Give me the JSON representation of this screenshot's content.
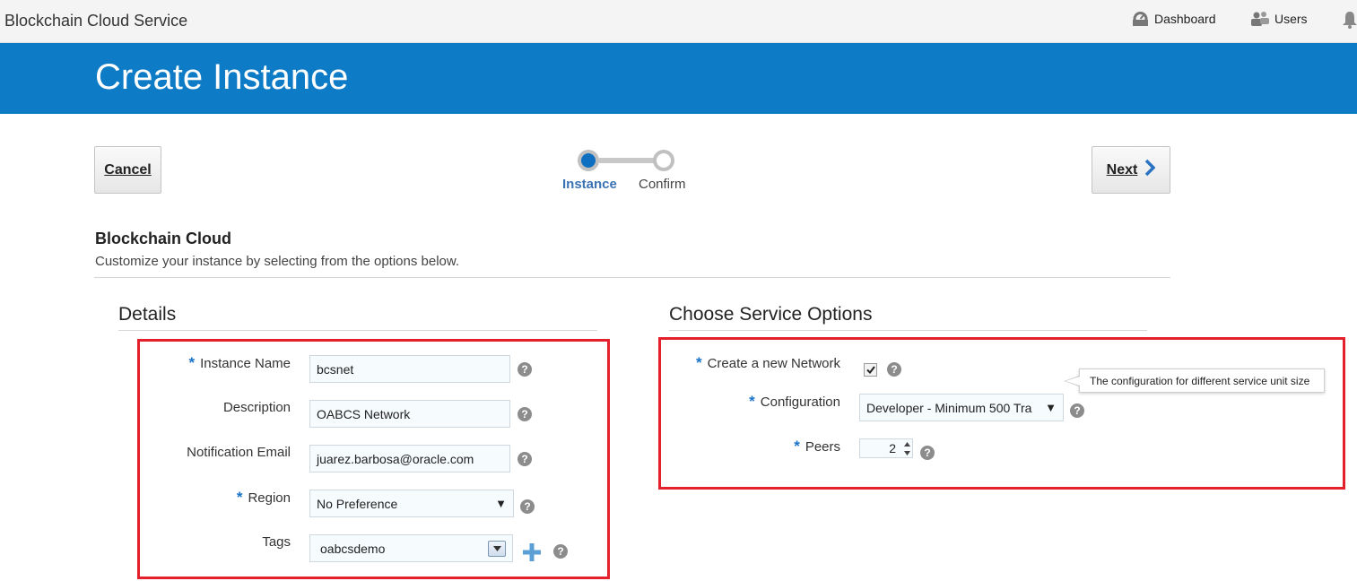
{
  "app": {
    "title": "Blockchain Cloud Service",
    "nav": {
      "dashboard_label": "Dashboard",
      "users_label": "Users"
    }
  },
  "header": {
    "title": "Create Instance"
  },
  "toolbar": {
    "cancel_label": "Cancel",
    "next_label": "Next"
  },
  "train": {
    "steps": [
      {
        "label": "Instance",
        "state": "current"
      },
      {
        "label": "Confirm",
        "state": "upcoming"
      }
    ]
  },
  "section": {
    "title": "Blockchain Cloud",
    "subtitle": "Customize your instance by selecting from the options below."
  },
  "details": {
    "title": "Details",
    "instance_name": {
      "label": "Instance Name",
      "value": "bcsnet",
      "required": true
    },
    "description": {
      "label": "Description",
      "value": "OABCS Network",
      "required": false
    },
    "notification_email": {
      "label": "Notification Email",
      "value": "juarez.barbosa@oracle.com",
      "required": false
    },
    "region": {
      "label": "Region",
      "value": "No Preference",
      "required": true
    },
    "tags": {
      "label": "Tags",
      "value": "oabcsdemo",
      "required": false
    }
  },
  "options": {
    "title": "Choose Service Options",
    "create_network": {
      "label": "Create a new Network",
      "checked": true,
      "required": true
    },
    "configuration": {
      "label": "Configuration",
      "value": "Developer - Minimum 500 Tra",
      "required": true
    },
    "peers": {
      "label": "Peers",
      "value": "2",
      "required": true
    },
    "tooltip": "The configuration for different service unit size"
  },
  "common": {
    "required_marker": "*",
    "help_glyph": "?"
  },
  "colors": {
    "brand_blue": "#0e7bc7",
    "highlight_red": "#e3202b",
    "required_blue": "#1a73c9",
    "train_active": "#0e6fc1"
  }
}
